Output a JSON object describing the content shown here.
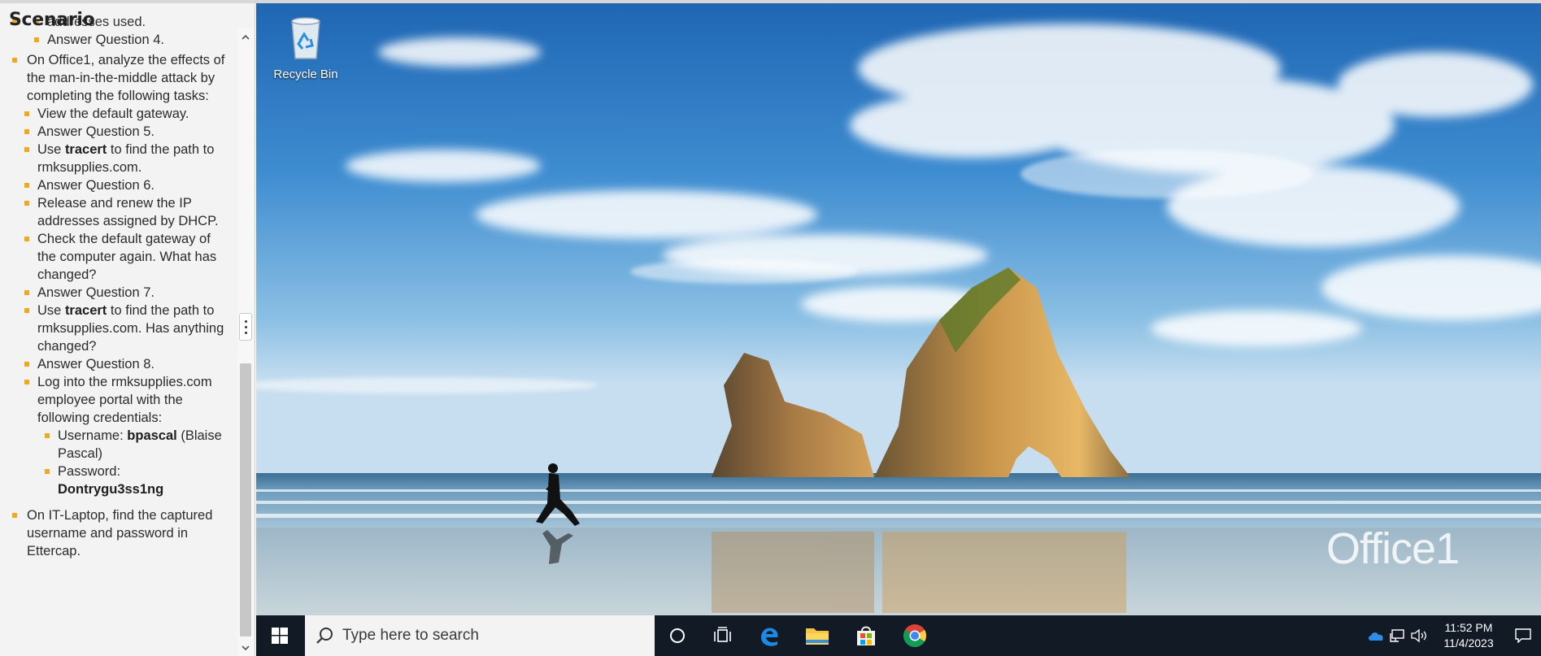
{
  "scenario": {
    "title": "Scenario",
    "top_cut_text": "addresses used.",
    "answer_q4": "Answer Question 4.",
    "office_task": "On Office1, analyze the effects of the man-in-the-middle attack by completing the following tasks:",
    "items": {
      "view_gateway": "View the default gateway.",
      "answer_q5": "Answer Question 5.",
      "use1": "Use ",
      "tracert1": "tracert",
      "tracert_rest1": " to find the path to rmksupplies.com.",
      "answer_q6": "Answer Question 6.",
      "release_renew": "Release and renew the IP addresses assigned by DHCP.",
      "check_gateway": "Check the default gateway of the computer again. What has changed?",
      "answer_q7": "Answer Question 7.",
      "use2": "Use ",
      "tracert2": "tracert",
      "tracert_rest2": " to find the path to rmksupplies.com. Has anything changed?",
      "answer_q8": "Answer Question 8.",
      "login": "Log into the rmksupplies.com employee portal with the following credentials:",
      "username_label": "Username: ",
      "username_value": "bpascal",
      "username_note": "(Blaise Pascal)",
      "password_label": "Password: ",
      "password_value": "Dontrygu3ss1ng"
    },
    "it_laptop_task": "On IT-Laptop, find the captured username and password in Ettercap."
  },
  "desktop": {
    "recycle_bin_label": "Recycle Bin",
    "vm_name": "Office1"
  },
  "taskbar": {
    "search_placeholder": "Type here to search",
    "apps": [
      "cortana-icon",
      "task-view-icon",
      "edge-icon",
      "file-explorer-icon",
      "store-icon",
      "chrome-icon"
    ],
    "clock_time": "11:52 PM",
    "clock_date": "11/4/2023"
  },
  "colors": {
    "bullet": "#f0a81c",
    "taskbar": "#121a26",
    "panel_bg": "#f3f3f3"
  }
}
